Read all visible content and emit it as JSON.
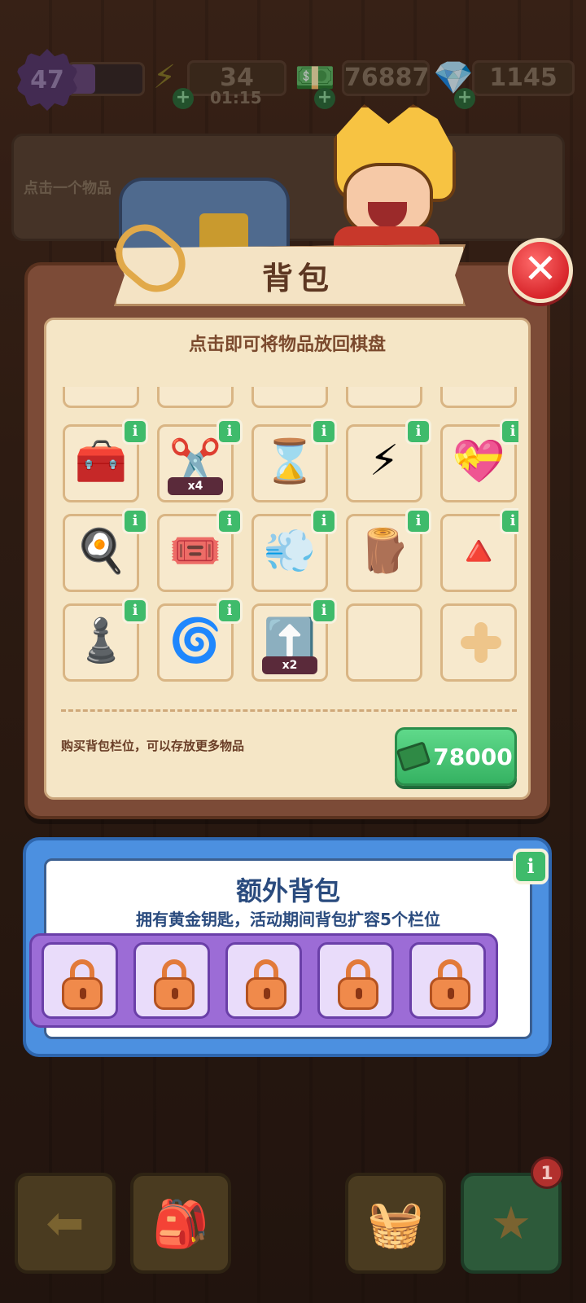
{
  "status": {
    "level": "47",
    "energy": "34",
    "energy_timer": "01:15",
    "cash": "76887",
    "gems": "1145"
  },
  "background_hint": "点击一个物品",
  "backpack": {
    "title": "背包",
    "subtitle": "点击即可将物品放回棋盘",
    "items": [
      {
        "icon": "treasure-chest-icon",
        "glyph": "🧰",
        "count": ""
      },
      {
        "icon": "scissors-bubble-icon",
        "glyph": "✂️",
        "count": "x4"
      },
      {
        "icon": "hourglass-icon",
        "glyph": "⌛",
        "count": ""
      },
      {
        "icon": "lightning-bubble-icon",
        "glyph": "⚡",
        "count": ""
      },
      {
        "icon": "heart-card-icon",
        "glyph": "💝",
        "count": ""
      },
      {
        "icon": "toast-egg-icon",
        "glyph": "🍳",
        "count": ""
      },
      {
        "icon": "tickets-icon",
        "glyph": "🎟️",
        "count": ""
      },
      {
        "icon": "hair-dryer-icon",
        "glyph": "💨",
        "count": ""
      },
      {
        "icon": "grinder-icon",
        "glyph": "🪵",
        "count": ""
      },
      {
        "icon": "cone-stand-icon",
        "glyph": "🔺",
        "count": ""
      },
      {
        "icon": "chess-piece-stand-icon",
        "glyph": "♟️",
        "count": ""
      },
      {
        "icon": "spring-stand-icon",
        "glyph": "🌀",
        "count": ""
      },
      {
        "icon": "upgrade-card-icon",
        "glyph": "⬆️",
        "count": "x2"
      }
    ],
    "info_label": "i",
    "buy_description": "购买背包栏位，可以存放更多物品",
    "buy_price": "78000"
  },
  "extra_bag": {
    "title": "额外背包",
    "subtitle": "拥有黄金钥匙，活动期间背包扩容5个栏位",
    "info_label": "i"
  },
  "bottom": {
    "badge": "1"
  },
  "colors": {
    "panel": "#7c4b37",
    "inner": "#f5e6c6",
    "accent_green": "#3fbb6b",
    "close_red": "#d8262b",
    "extra_blue": "#4c90e0",
    "slot_purple": "#9c6cd6"
  }
}
